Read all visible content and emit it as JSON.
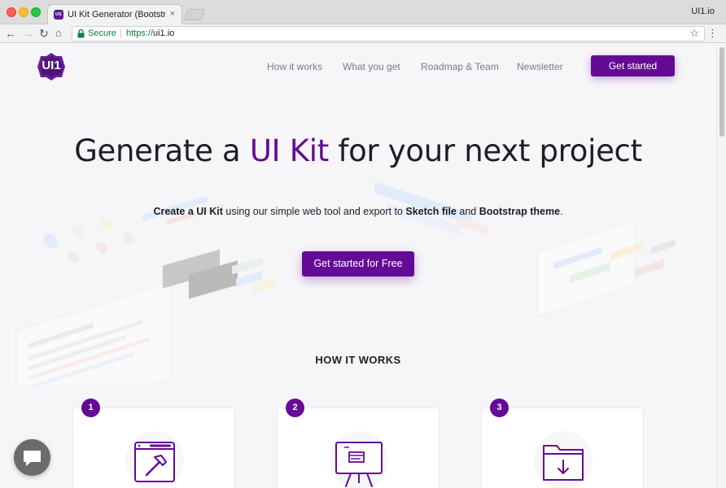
{
  "browser": {
    "tab_title": "UI Kit Generator (Bootstrap + S",
    "tab_close": "×",
    "profile_label": "UI1.io",
    "secure_label": "Secure",
    "url_protocol": "https://",
    "url_host": "ui1.io",
    "favicon_text": "UI1"
  },
  "header": {
    "logo_text": "UI1",
    "nav": [
      "How it works",
      "What you get",
      "Roadmap & Team",
      "Newsletter"
    ],
    "cta": "Get started"
  },
  "hero": {
    "title_prefix": "Generate a ",
    "title_accent": "UI Kit",
    "title_suffix": " for your next project",
    "subtitle": {
      "bold1": "Create a UI Kit",
      "text1": " using our simple web tool and export to ",
      "bold2": "Sketch file",
      "text2": " and ",
      "bold3": "Bootstrap theme",
      "text3": "."
    },
    "cta": "Get started for Free"
  },
  "how_it_works": {
    "title": "HOW IT WORKS",
    "steps": [
      {
        "number": "1",
        "icon": "window-hammer-icon"
      },
      {
        "number": "2",
        "icon": "presentation-board-icon"
      },
      {
        "number": "3",
        "icon": "folder-download-icon"
      }
    ]
  },
  "colors": {
    "brand": "#650a96",
    "text": "#1d1d24",
    "nav_text": "#7a7a85",
    "secure_green": "#0b8043"
  }
}
